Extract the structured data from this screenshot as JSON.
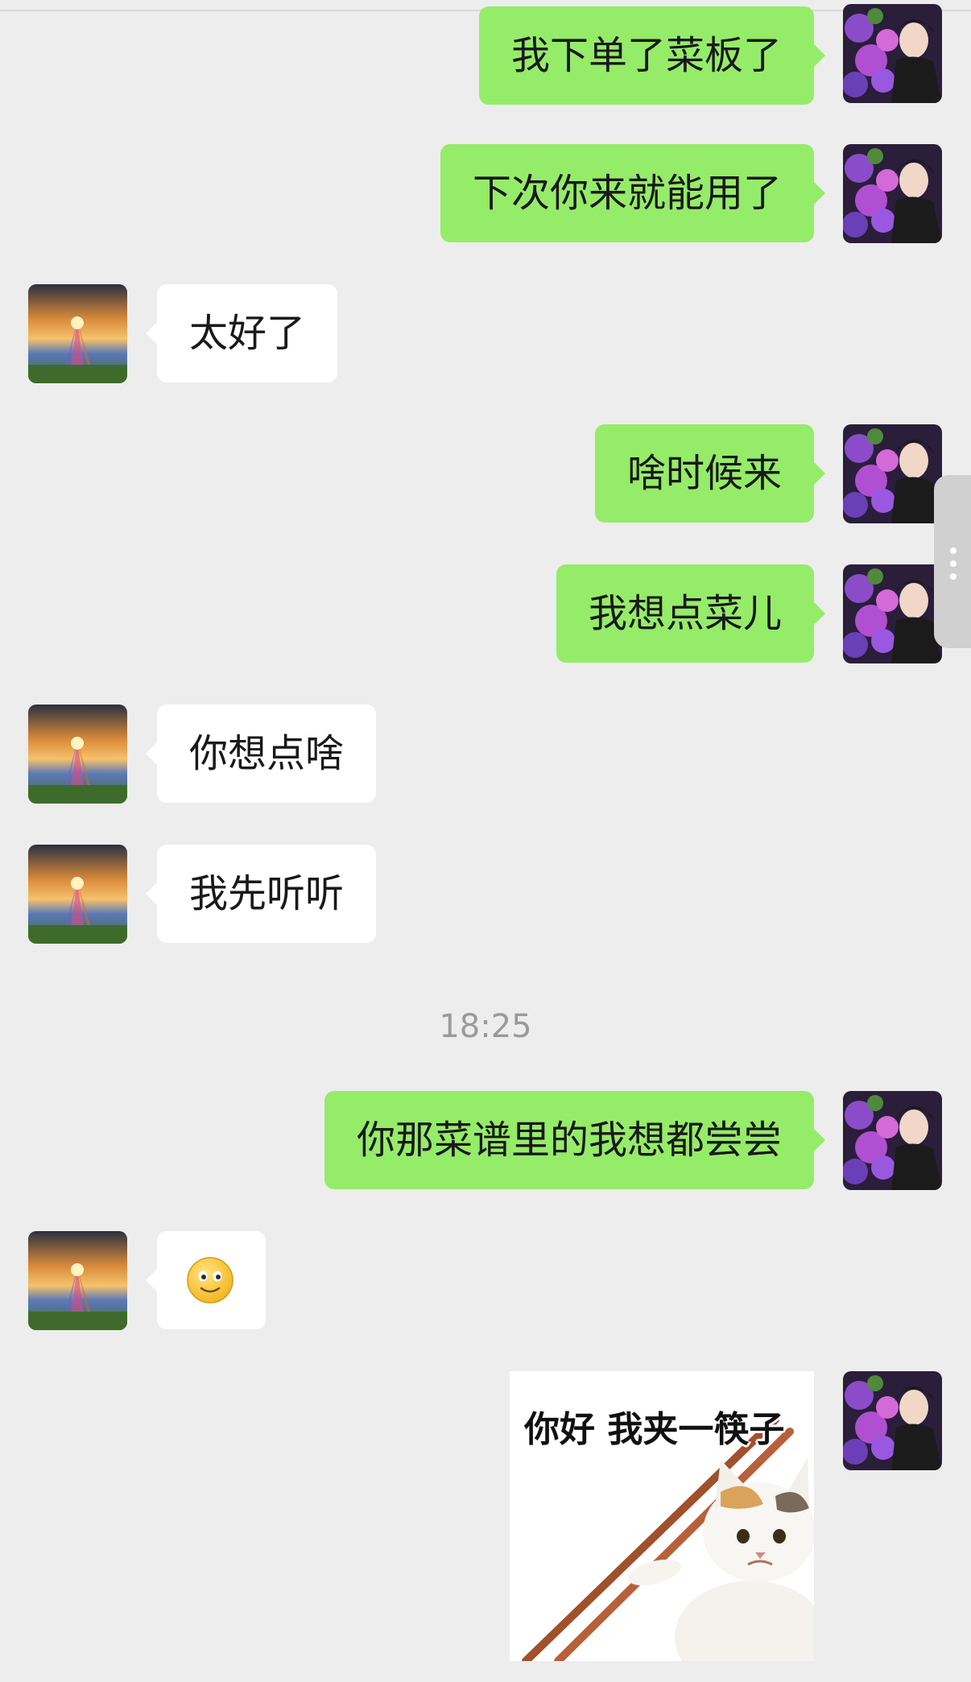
{
  "messages": [
    {
      "sender": "me",
      "text": "我下单了菜板了"
    },
    {
      "sender": "me",
      "text": "下次你来就能用了"
    },
    {
      "sender": "other",
      "text": "太好了"
    },
    {
      "sender": "me",
      "text": "啥时候来"
    },
    {
      "sender": "me",
      "text": "我想点菜儿"
    },
    {
      "sender": "other",
      "text": "你想点啥"
    },
    {
      "sender": "other",
      "text": "我先听听"
    },
    {
      "sender": "me",
      "text": "你那菜谱里的我想都尝尝"
    },
    {
      "sender": "other",
      "emoji": "smile-emoji"
    },
    {
      "sender": "me",
      "sticker_text": "你好 我夹一筷子"
    }
  ],
  "timestamp": "18:25",
  "colors": {
    "background": "#ededed",
    "my_bubble": "#95ec69",
    "other_bubble": "#ffffff",
    "text": "#191919",
    "timestamp": "#9a9a9a"
  },
  "icons": {
    "my_avatar": "hydrangea-portrait-avatar",
    "other_avatar": "sunset-landscape-avatar",
    "scroll_handle": "vertical-dots-icon"
  }
}
